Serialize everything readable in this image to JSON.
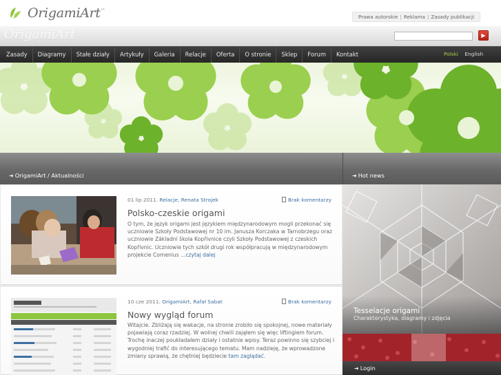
{
  "header": {
    "logo_text": "OrigamiArt",
    "logo_tm": "™",
    "ghost_logo_text": "OrigamiArt",
    "top_links": [
      "Prawa autorskie",
      "Reklama",
      "Zasady publikacji"
    ],
    "search_placeholder": "",
    "search_button_icon": "arrow-right-icon"
  },
  "nav": {
    "items": [
      "Zasady",
      "Diagramy",
      "Stałe działy",
      "Artykuły",
      "Galeria",
      "Relacje",
      "Oferta",
      "O stronie",
      "Sklep",
      "Forum",
      "Kontakt"
    ],
    "languages": [
      {
        "label": "Polski",
        "active": true
      },
      {
        "label": "English",
        "active": false
      }
    ]
  },
  "colors": {
    "accent_green": "#8cc63f",
    "link_blue": "#3b6fa0",
    "nav_bg": "#2f2f2f",
    "search_button_red": "#c9342a"
  },
  "main": {
    "breadcrumb": "OrigamiArt / Aktualności",
    "posts": [
      {
        "date": "01 lip 2011.",
        "category": "Relacje",
        "author": "Renata Strojek",
        "comments": "Brak komentarzy",
        "title": "Polsko-czeskie origami",
        "body": "O tym, że język origami jest językiem międzynarodowym mogli przekonać się uczniowie Szkoły Podstawowej nr 10 im. Janusza Korczaka w Tarnobrzegu oraz uczniowie Základní škola Kopřivnice czyli Szkoły Podstawowej z czeskich Kopřivnic. Uczniowie tych szkół drugi rok współpracują w międzynarodowym projekcie Comenius ...",
        "more": "czytaj dalej"
      },
      {
        "date": "10 cze 2011.",
        "category": "OrigamiArt",
        "author": "Rafał Sabat",
        "comments": "Brak komentarzy",
        "title": "Nowy wygląd forum",
        "body": "Witajcie. Zbliżają się wakacje, na stronie zrobiło się spokojnej, nowe materiały pojawiają coraz rzadziej. W wolnej chwili zająłem się więc liftingiem forum. Trochę inaczej poukładałem działy i ostatnie wpisy. Teraz powinno się szybciej i wygodniej trafić do interesującego tematu. Mam nadzieję, że wprowadzone zmiany sprawią, że chętniej będziecie",
        "more": "tam zaglądać."
      }
    ]
  },
  "sidebar": {
    "hot_news_label": "Hot news",
    "hot_title": "Tesselacje origami",
    "hot_subtitle": "Charakterystyka, diagramy i zdjęcia",
    "login_label": "Login"
  }
}
